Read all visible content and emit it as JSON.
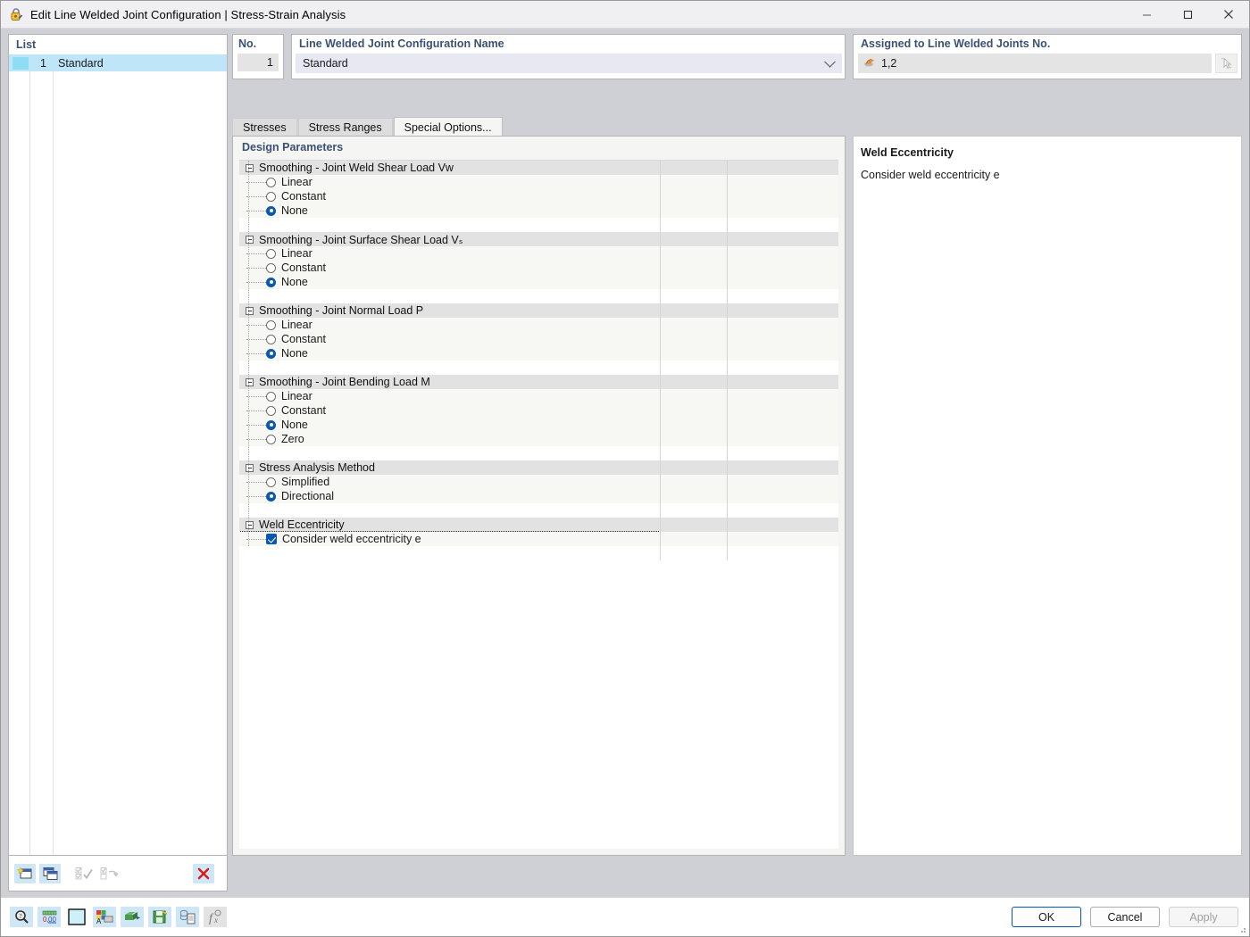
{
  "window": {
    "title": "Edit Line Welded Joint Configuration | Stress-Strain Analysis",
    "icon": "lock-icon",
    "minimize": "—",
    "maximize": "❐",
    "close": "✕"
  },
  "list": {
    "header": "List",
    "rows": [
      {
        "num": "1",
        "name": "Standard",
        "selected": true
      }
    ],
    "toolbar": [
      {
        "name": "new-configuration-button",
        "glyph": "new-window-star-icon",
        "disabled": false
      },
      {
        "name": "copy-configuration-button",
        "glyph": "copy-window-icon",
        "disabled": false
      },
      {
        "name": "select-all-button",
        "glyph": "check-all-icon",
        "disabled": true
      },
      {
        "name": "invert-selection-button",
        "glyph": "invert-selection-icon",
        "disabled": true
      },
      {
        "name": "delete-configuration-button",
        "glyph": "red-x-icon",
        "disabled": false
      }
    ]
  },
  "no_panel": {
    "label": "No.",
    "value": "1"
  },
  "name_panel": {
    "label": "Line Welded Joint Configuration Name",
    "value": "Standard"
  },
  "assigned_panel": {
    "label": "Assigned to Line Welded Joints No.",
    "value": "1,2",
    "field_icon": "welded-joint-icon",
    "pick_icon": "pick-cursor-icon"
  },
  "tabs": [
    {
      "label": "Stresses",
      "active": false
    },
    {
      "label": "Stress Ranges",
      "active": false
    },
    {
      "label": "Special Options...",
      "active": true
    }
  ],
  "content": {
    "title": "Design Parameters",
    "groups": [
      {
        "title": "Smoothing - Joint Weld Shear Load Vᴡ",
        "type": "radio",
        "options": [
          {
            "label": "Linear",
            "selected": false
          },
          {
            "label": "Constant",
            "selected": false
          },
          {
            "label": "None",
            "selected": true
          }
        ]
      },
      {
        "title": "Smoothing - Joint Surface Shear Load Vₛ",
        "type": "radio",
        "options": [
          {
            "label": "Linear",
            "selected": false
          },
          {
            "label": "Constant",
            "selected": false
          },
          {
            "label": "None",
            "selected": true
          }
        ]
      },
      {
        "title": "Smoothing - Joint Normal Load P",
        "type": "radio",
        "options": [
          {
            "label": "Linear",
            "selected": false
          },
          {
            "label": "Constant",
            "selected": false
          },
          {
            "label": "None",
            "selected": true
          }
        ]
      },
      {
        "title": "Smoothing - Joint Bending Load M",
        "type": "radio",
        "options": [
          {
            "label": "Linear",
            "selected": false
          },
          {
            "label": "Constant",
            "selected": false
          },
          {
            "label": "None",
            "selected": true
          },
          {
            "label": "Zero",
            "selected": false
          }
        ]
      },
      {
        "title": "Stress Analysis Method",
        "type": "radio",
        "options": [
          {
            "label": "Simplified",
            "selected": false
          },
          {
            "label": "Directional",
            "selected": true
          }
        ]
      },
      {
        "title": "Weld Eccentricity",
        "type": "checkbox",
        "options": [
          {
            "label": "Consider weld eccentricity e",
            "selected": true,
            "focused": true
          }
        ]
      }
    ]
  },
  "info": {
    "title": "Weld Eccentricity",
    "text": "Consider weld eccentricity e"
  },
  "footer": {
    "tools": [
      {
        "name": "search-tool-button",
        "glyph": "magnifier-icon"
      },
      {
        "name": "units-tool-button",
        "glyph": "number-format-icon"
      },
      {
        "name": "color-tool-button",
        "glyph": "color-swatch-icon"
      },
      {
        "name": "annotation-tool-button",
        "glyph": "label-style-icon"
      },
      {
        "name": "import-tool-button",
        "glyph": "import-icon"
      },
      {
        "name": "save-tool-button",
        "glyph": "save-as-icon"
      },
      {
        "name": "report-tool-button",
        "glyph": "report-icon"
      },
      {
        "name": "formula-tool-button",
        "glyph": "function-icon"
      }
    ],
    "ok": "OK",
    "cancel": "Cancel",
    "apply": "Apply"
  },
  "colors": {
    "accent_blue": "#0a59b0",
    "header_text": "#3b5173",
    "selection": "#bfe5f8",
    "group_header": "#e2e2e2",
    "row_bg": "#f7f8f3",
    "toolbar_btn": "#cfe6f7",
    "delete_red": "#d81e1e"
  }
}
